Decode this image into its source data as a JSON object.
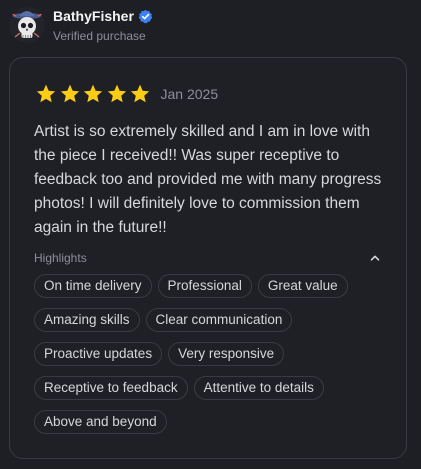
{
  "reviewer": {
    "name": "BathyFisher",
    "subtitle": "Verified purchase",
    "avatar_icon": "skull-avatar-icon",
    "verified_icon": "verified-check-icon",
    "verified_color": "#3b82f6"
  },
  "review": {
    "rating": 5,
    "max_rating": 5,
    "star_color": "#facc15",
    "date": "Jan 2025",
    "text": "Artist is so extremely skilled and I am in love with the piece I received!! Was super receptive to feedback too and provided me with many progress photos! I will definitely love to commission them again in the future!!"
  },
  "highlights": {
    "label": "Highlights",
    "toggle_icon": "chevron-up-icon",
    "tags": [
      "On time delivery",
      "Professional",
      "Great value",
      "Amazing skills",
      "Clear communication",
      "Proactive updates",
      "Very responsive",
      "Receptive to feedback",
      "Attentive to details",
      "Above and beyond"
    ]
  }
}
